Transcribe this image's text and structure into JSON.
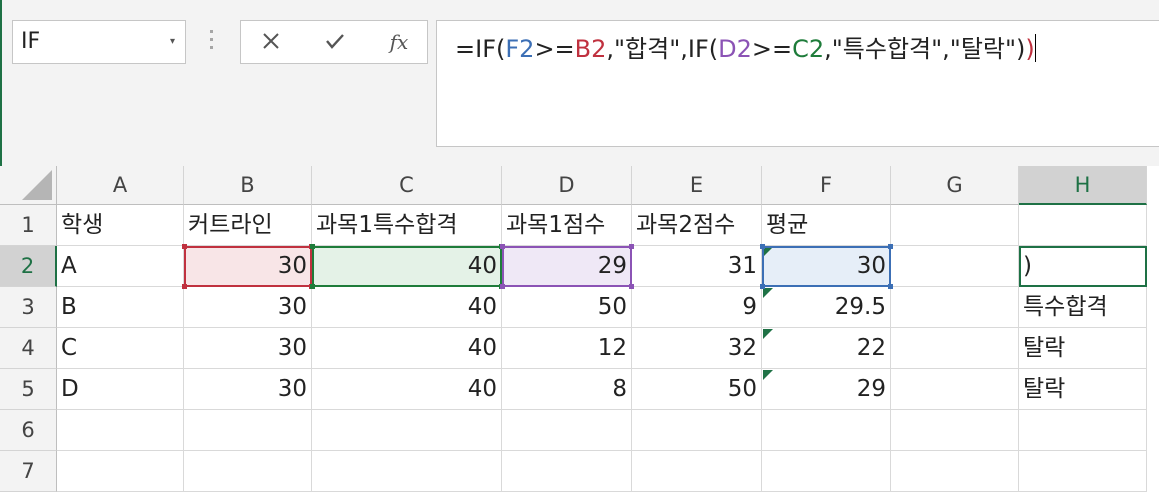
{
  "name_box": {
    "value": "IF"
  },
  "formula_bar": {
    "parts": [
      {
        "text": "=IF(",
        "color": "#222222"
      },
      {
        "text": "F2",
        "color": "#3c6fb5"
      },
      {
        "text": ">=",
        "color": "#222222"
      },
      {
        "text": "B2",
        "color": "#c0313f"
      },
      {
        "text": ",\"합격\",IF(",
        "color": "#222222"
      },
      {
        "text": "D2",
        "color": "#8b53b5"
      },
      {
        "text": ">=",
        "color": "#222222"
      },
      {
        "text": "C2",
        "color": "#1e7c3a"
      },
      {
        "text": ",\"특수합격\",\"탈락\")",
        "color": "#222222"
      },
      {
        "text": ")",
        "color": "#c0313f"
      }
    ]
  },
  "icons": {
    "cancel": "close-icon",
    "enter": "checkmark-icon",
    "fx_label": "fx"
  },
  "columns": [
    "A",
    "B",
    "C",
    "D",
    "E",
    "F",
    "G",
    "H"
  ],
  "selected_column": "H",
  "rows": [
    "1",
    "2",
    "3",
    "4",
    "5",
    "6",
    "7"
  ],
  "selected_row": "2",
  "cells": {
    "headers": [
      "학생",
      "커트라인",
      "과목1특수합격",
      "과목1점수",
      "과목2점수",
      "평균",
      "",
      ""
    ],
    "data": [
      [
        "A",
        "30",
        "40",
        "29",
        "31",
        "30",
        "",
        ")"
      ],
      [
        "B",
        "30",
        "40",
        "50",
        "9",
        "29.5",
        "",
        "특수합격"
      ],
      [
        "C",
        "30",
        "40",
        "12",
        "32",
        "22",
        "",
        "탈락"
      ],
      [
        "D",
        "30",
        "40",
        "8",
        "50",
        "29",
        "",
        "탈락"
      ]
    ]
  },
  "reference_colors": {
    "B2": {
      "border": "#c0313f",
      "fill": "#f8e5e7"
    },
    "C2": {
      "border": "#1e7c3a",
      "fill": "#e4f2e7"
    },
    "D2": {
      "border": "#8b53b5",
      "fill": "#efe8f6"
    },
    "F2": {
      "border": "#3c6fb5",
      "fill": "#e6eef8"
    }
  },
  "active_cell_border": "#1e7145"
}
